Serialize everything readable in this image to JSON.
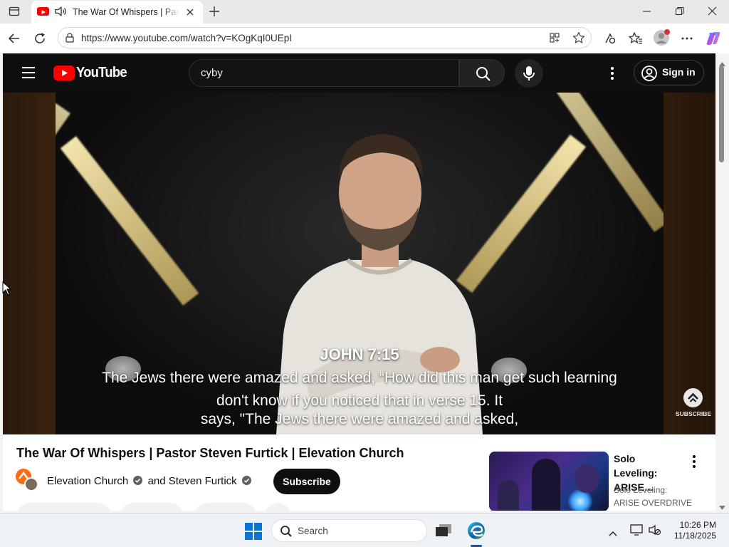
{
  "browser": {
    "tab_title": "The War Of Whispers | Pastor Steven Furtick | Elevation Church",
    "url": "https://www.youtube.com/watch?v=KOgKqI0UEpI"
  },
  "youtube": {
    "logo_text": "YouTube",
    "search_value": "cyby",
    "sign_in_label": "Sign in"
  },
  "video": {
    "caption_heading": "JOHN 7:15",
    "caption_verse": "The Jews there were amazed and asked, “How did this man get such learning",
    "subtitle_line1": "don't know if you noticed that in verse 15. It",
    "subtitle_line2": "says, \"The Jews there were amazed and asked,",
    "subscribe_watermark": "SUBSCRIBE",
    "title": "The War Of Whispers | Pastor Steven Furtick | Elevation Church",
    "channel_1": "Elevation Church",
    "channel_joiner": "and",
    "channel_2": "Steven Furtick",
    "subscribe_label": "Subscribe"
  },
  "recommendation": {
    "title": "Solo Leveling: ARISE…",
    "meta_line1": "Solo Leveling:",
    "meta_line2": "ARISE OVERDRIVE"
  },
  "taskbar": {
    "search_placeholder": "Search",
    "time": "10:26 PM",
    "date": "11/18/2025"
  },
  "colors": {
    "youtube_red": "#ff0000",
    "yt_dark": "#0f0f0f",
    "edge_blue": "#0c59a4"
  }
}
